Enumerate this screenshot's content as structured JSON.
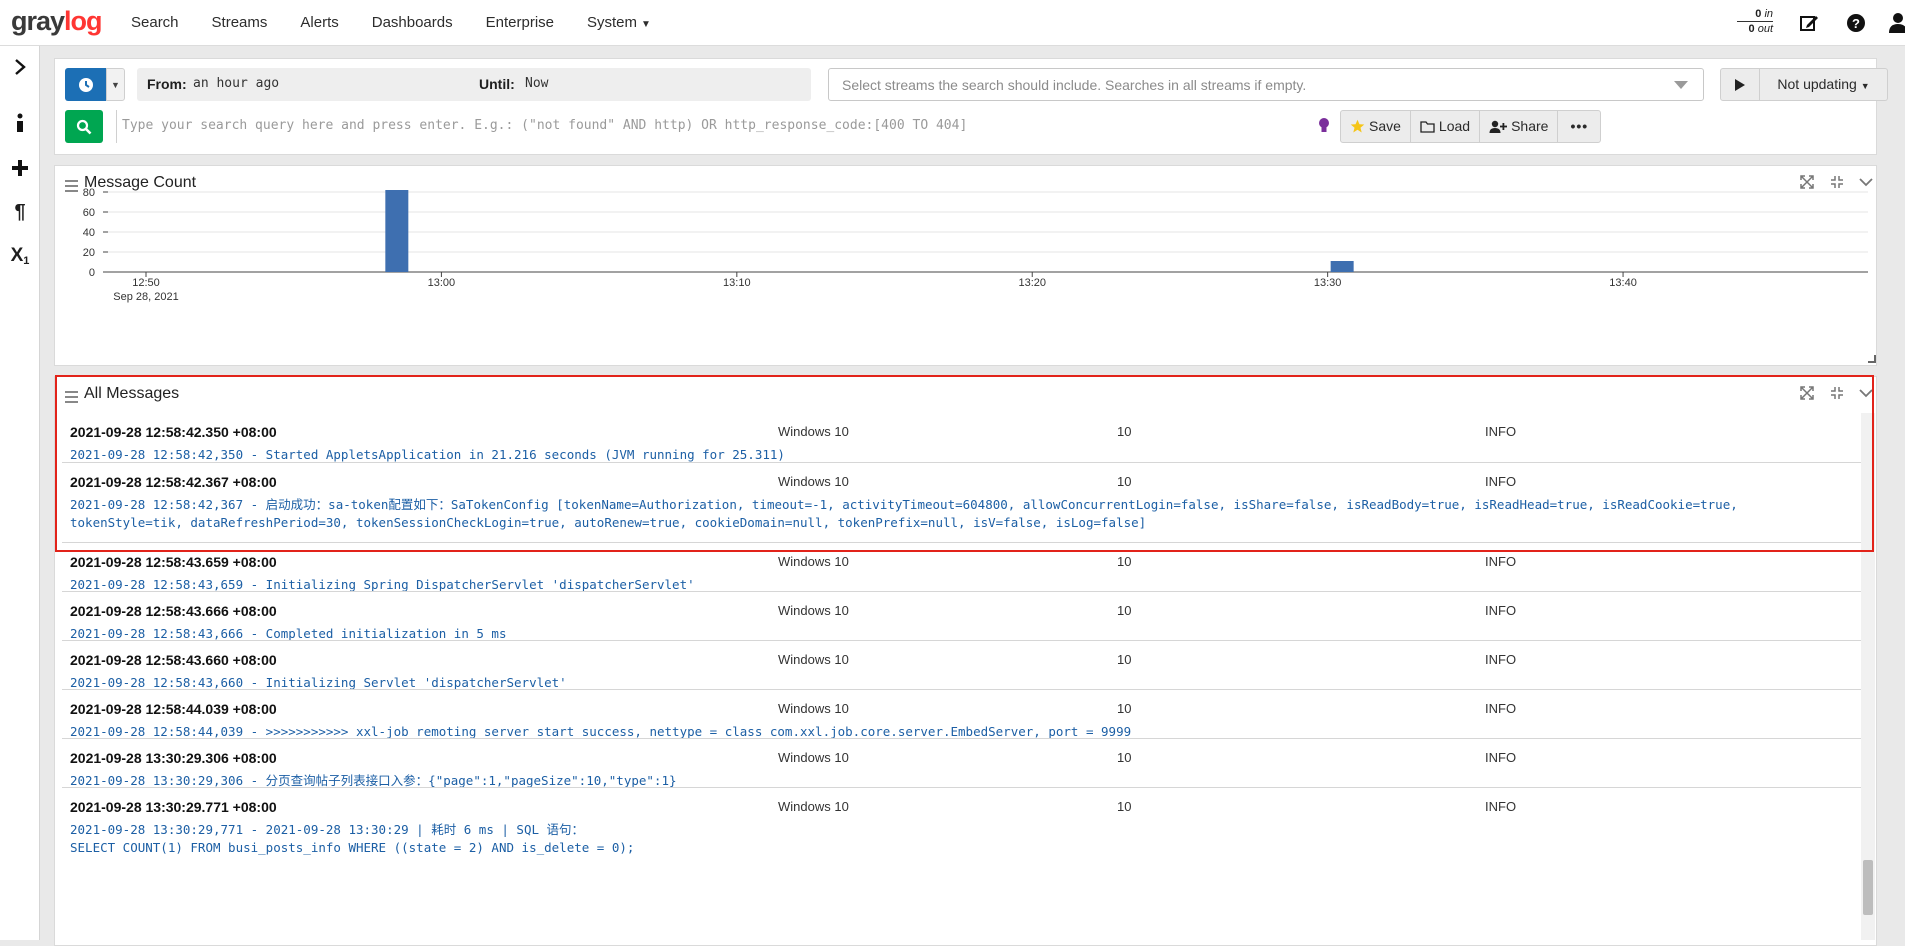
{
  "navbar": {
    "logo_main": "gray",
    "logo_accent": "log",
    "items": [
      {
        "label": "Search"
      },
      {
        "label": "Streams"
      },
      {
        "label": "Alerts"
      },
      {
        "label": "Dashboards"
      },
      {
        "label": "Enterprise"
      },
      {
        "label": "System",
        "has_caret": true
      }
    ],
    "throughput": {
      "in_count": "0",
      "in_label": "in",
      "out_count": "0",
      "out_label": "out"
    }
  },
  "sidebar": {
    "icons": [
      "chevron-right-icon",
      "info-icon",
      "plus-icon",
      "paragraph-icon",
      "subscript-icon"
    ]
  },
  "search": {
    "from_label": "From:",
    "from_value": "an hour ago",
    "until_label": "Until:",
    "until_value": "Now",
    "streams_placeholder": "Select streams the search should include. Searches in all streams if empty.",
    "refresh_label": "Not updating",
    "query_placeholder": "Type your search query here and press enter. E.g.: (\"not found\" AND http) OR http_response_code:[400 TO 404]",
    "actions": {
      "save": "Save",
      "load": "Load",
      "share": "Share"
    }
  },
  "message_count_widget": {
    "title": "Message Count"
  },
  "chart_data": {
    "type": "bar",
    "title": "Message Count",
    "x_ticks": [
      "12:50",
      "13:00",
      "13:10",
      "13:20",
      "13:30",
      "13:40"
    ],
    "x_date_label": "Sep 28, 2021",
    "y_ticks": [
      0,
      20,
      40,
      60,
      80
    ],
    "ylim": [
      0,
      90
    ],
    "x_range": [
      "12:50",
      "13:48"
    ],
    "bars": [
      {
        "time": "12:58",
        "value": 82
      },
      {
        "time": "13:30",
        "value": 11
      }
    ],
    "bar_color": "#3e6fb0",
    "grid": true
  },
  "all_messages_widget": {
    "title": "All Messages",
    "messages": [
      {
        "timestamp": "2021-09-28 12:58:42.350 +08:00",
        "source": "Windows 10",
        "level_num": "10",
        "level": "INFO",
        "text": "2021-09-28 12:58:42,350 - Started AppletsApplication in 21.216 seconds (JVM running for 25.311)"
      },
      {
        "timestamp": "2021-09-28 12:58:42.367 +08:00",
        "source": "Windows 10",
        "level_num": "10",
        "level": "INFO",
        "text": "2021-09-28 12:58:42,367 - 启动成功：sa-token配置如下：SaTokenConfig [tokenName=Authorization, timeout=-1, activityTimeout=604800, allowConcurrentLogin=false, isShare=false, isReadBody=true, isReadHead=true, isReadCookie=true, tokenStyle=tik, dataRefreshPeriod=30, tokenSessionCheckLogin=true, autoRenew=true, cookieDomain=null, tokenPrefix=null, isV=false, isLog=false]"
      },
      {
        "timestamp": "2021-09-28 12:58:43.659 +08:00",
        "source": "Windows 10",
        "level_num": "10",
        "level": "INFO",
        "text": "2021-09-28 12:58:43,659 - Initializing Spring DispatcherServlet 'dispatcherServlet'"
      },
      {
        "timestamp": "2021-09-28 12:58:43.666 +08:00",
        "source": "Windows 10",
        "level_num": "10",
        "level": "INFO",
        "text": "2021-09-28 12:58:43,666 - Completed initialization in 5 ms"
      },
      {
        "timestamp": "2021-09-28 12:58:43.660 +08:00",
        "source": "Windows 10",
        "level_num": "10",
        "level": "INFO",
        "text": "2021-09-28 12:58:43,660 - Initializing Servlet 'dispatcherServlet'"
      },
      {
        "timestamp": "2021-09-28 12:58:44.039 +08:00",
        "source": "Windows 10",
        "level_num": "10",
        "level": "INFO",
        "text": "2021-09-28 12:58:44,039 - >>>>>>>>>>> xxl-job remoting server start success, nettype = class com.xxl.job.core.server.EmbedServer, port = 9999"
      },
      {
        "timestamp": "2021-09-28 13:30:29.306 +08:00",
        "source": "Windows 10",
        "level_num": "10",
        "level": "INFO",
        "text": "2021-09-28 13:30:29,306 - 分页查询帖子列表接口入参：{\"page\":1,\"pageSize\":10,\"type\":1}"
      },
      {
        "timestamp": "2021-09-28 13:30:29.771 +08:00",
        "source": "Windows 10",
        "level_num": "10",
        "level": "INFO",
        "text": "2021-09-28 13:30:29,771 - 2021-09-28 13:30:29 | 耗时 6 ms | SQL 语句：\nSELECT COUNT(1) FROM busi_posts_info WHERE ((state = 2) AND is_delete = 0);"
      }
    ]
  },
  "colors": {
    "primary_blue": "#1c6fb5",
    "search_green": "#00a651",
    "message_text": "#1c5fa5",
    "highlight_red": "#e2231a",
    "logo_red": "#ff3633"
  }
}
